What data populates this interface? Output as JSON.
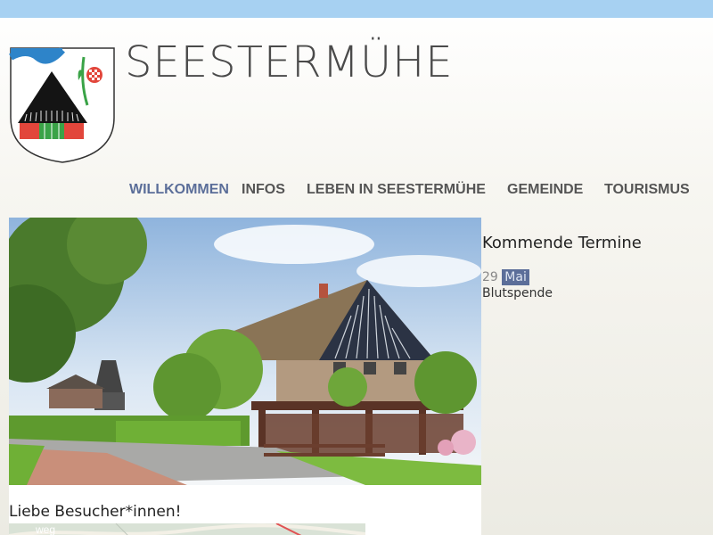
{
  "header": {
    "site_title": "SEESTERMÜHE"
  },
  "nav": {
    "items": [
      {
        "label": "WILLKOMMEN",
        "active": true
      },
      {
        "label": "INFOS"
      },
      {
        "label": "LEBEN IN SEESTERMÜHE"
      },
      {
        "label": "GEMEINDE"
      },
      {
        "label": "TOURISMUS"
      }
    ]
  },
  "main": {
    "welcome_heading": "Liebe Besucher*innen!",
    "map_label": "weg"
  },
  "sidebar": {
    "title": "Kommende Termine",
    "events": [
      {
        "day": "29",
        "month": "Mai",
        "name": "Blutspende"
      }
    ]
  },
  "colors": {
    "top_bar": "#a7d1f2",
    "nav_active": "#5b6e99",
    "nav_default": "#555555"
  }
}
